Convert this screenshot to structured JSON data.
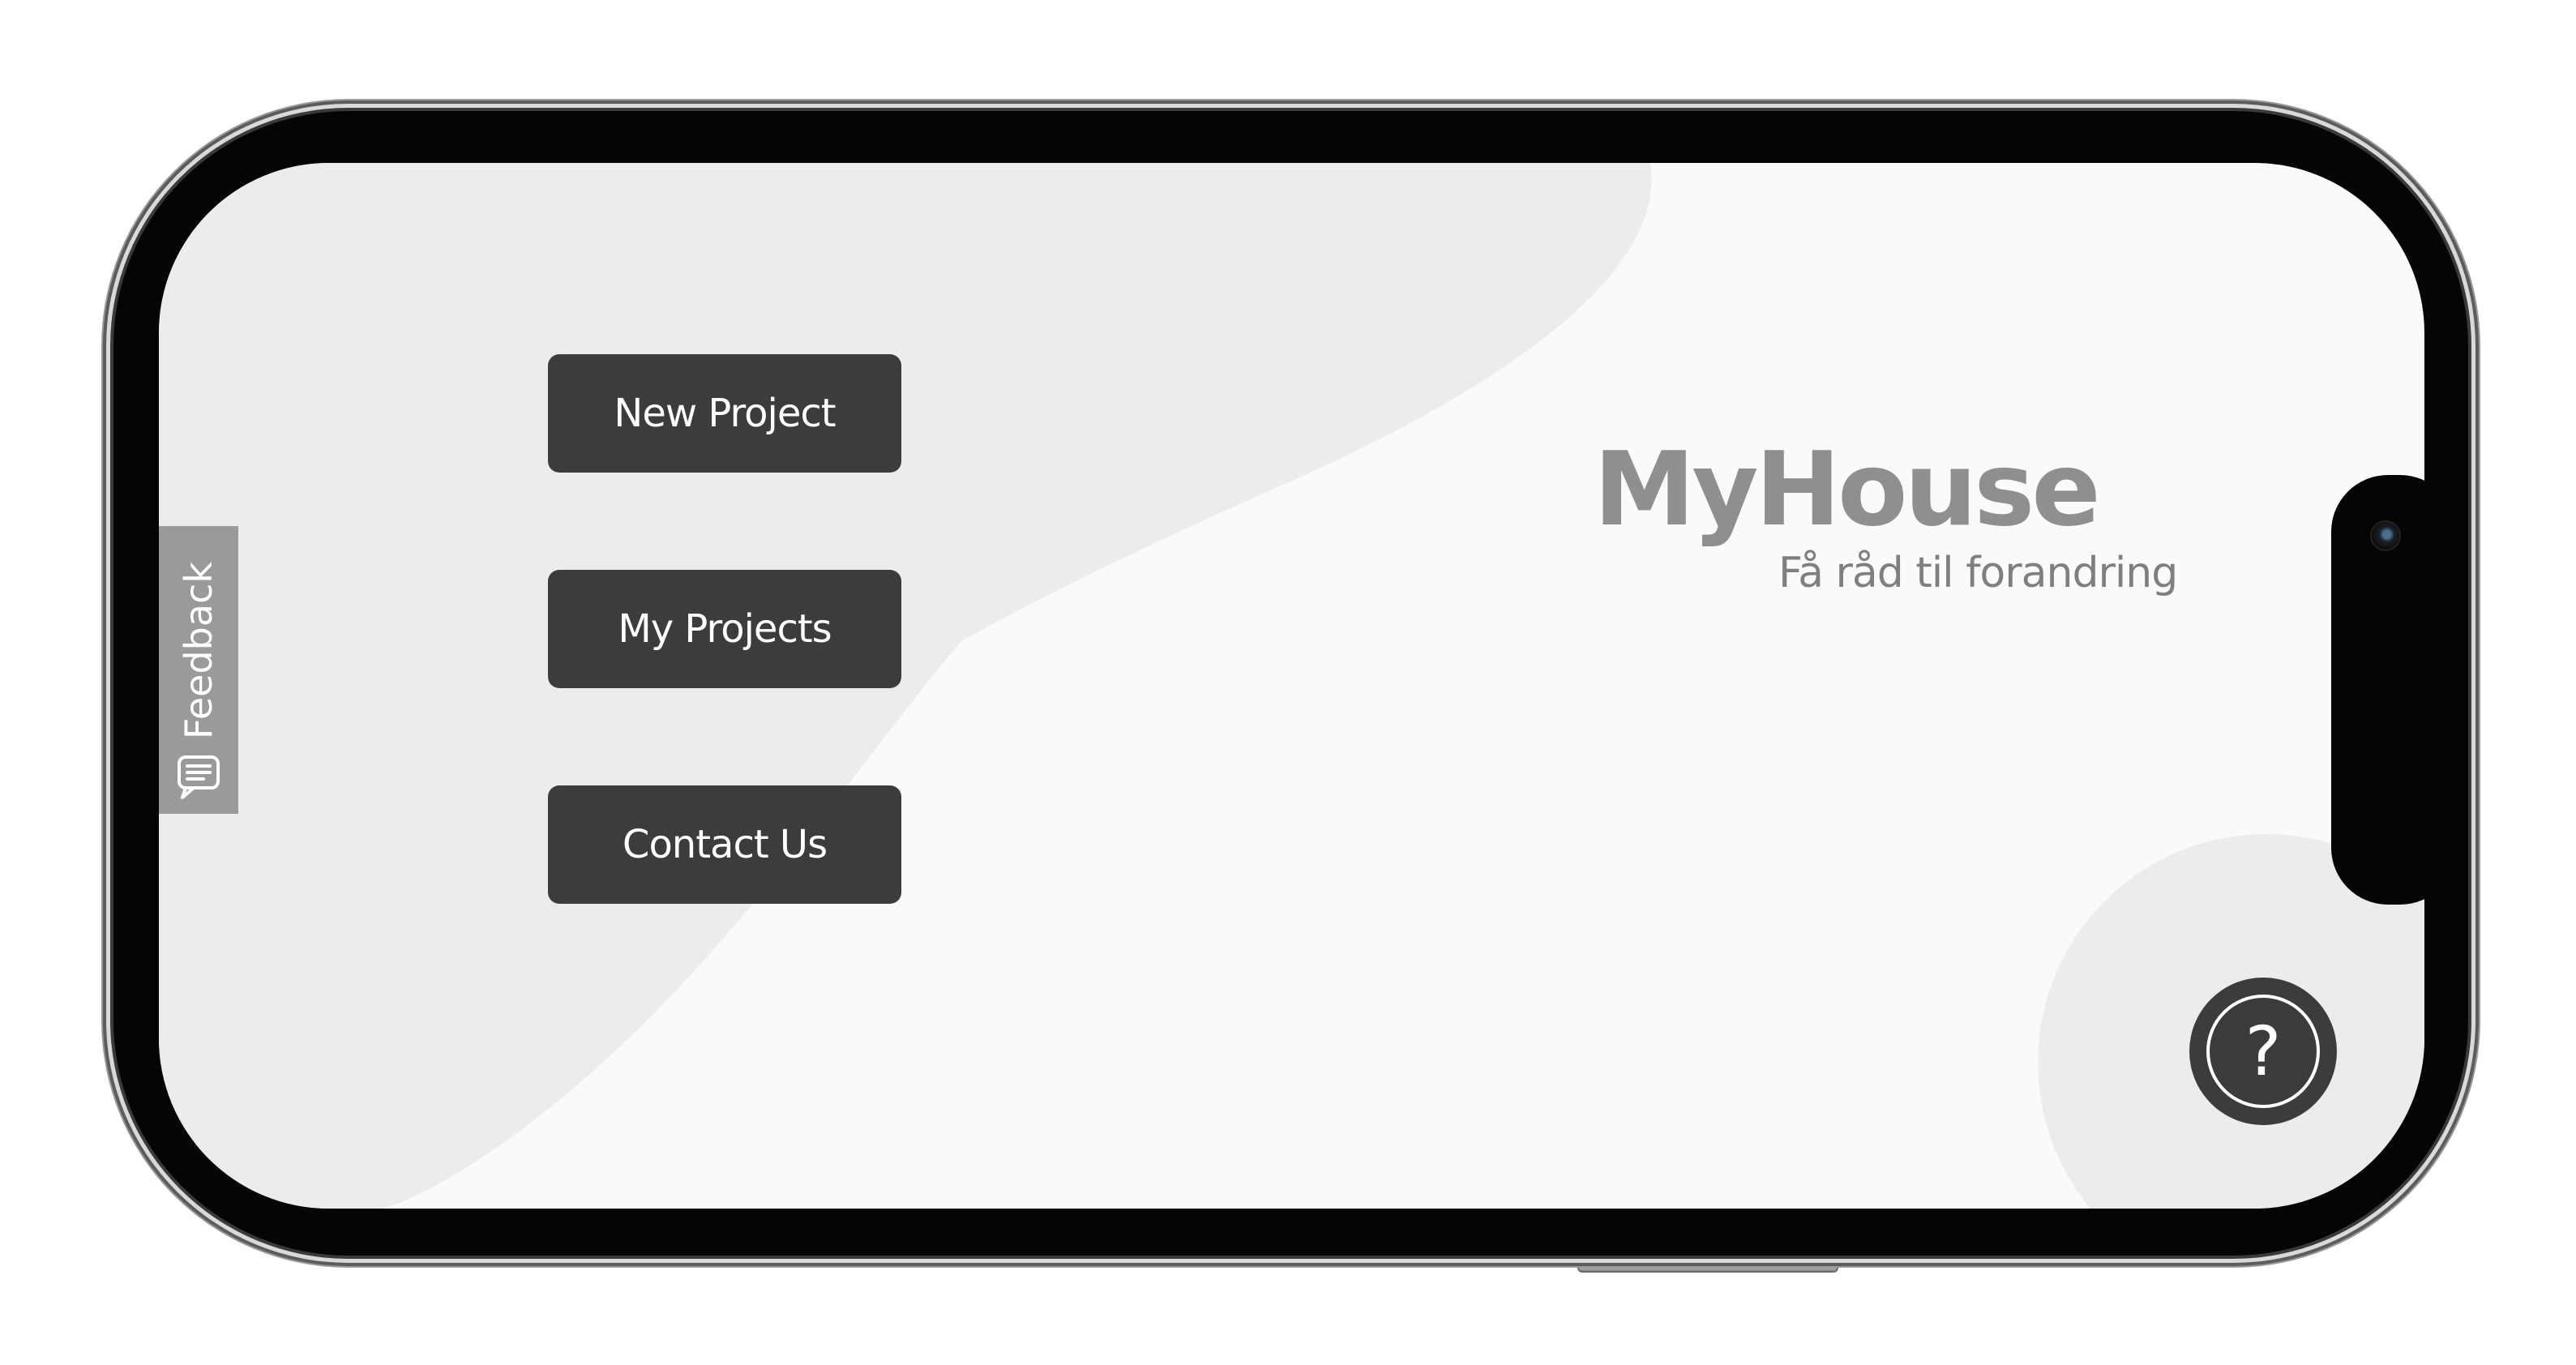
{
  "menu": {
    "new_project": "New Project",
    "my_projects": "My Projects",
    "contact_us": "Contact Us"
  },
  "feedback": {
    "label": "Feedback",
    "icon": "chat-bubble-icon"
  },
  "brand": {
    "title": "MyHouse",
    "tagline": "Få råd til forandring"
  },
  "help": {
    "icon": "question-mark-icon",
    "symbol": "?"
  },
  "colors": {
    "button_bg": "#3c3c3c",
    "button_text": "#ffffff",
    "screen_bg": "#fafafa",
    "shape_bg": "#ececec",
    "brand_text": "#8f8f8f",
    "feedback_bg": "#9a9a9a"
  }
}
